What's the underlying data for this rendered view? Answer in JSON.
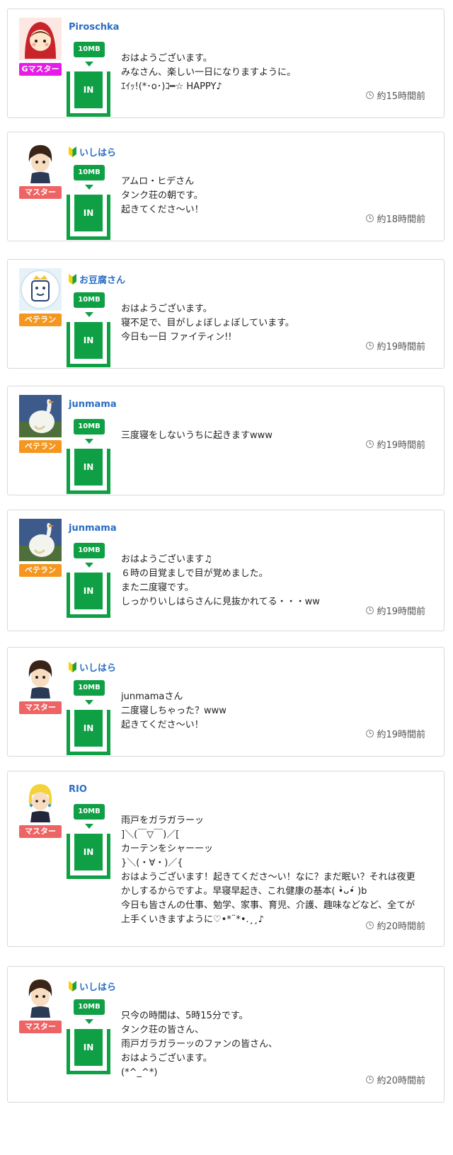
{
  "colors": {
    "in_green": "#0f9f45",
    "username_blue": "#2a6ec4",
    "rank_gmaster": "#e61ce6",
    "rank_master": "#ee6464",
    "rank_veteran": "#f5961e"
  },
  "posts": [
    {
      "username": "Piroschka",
      "rank": "Gマスター",
      "beginner": false,
      "size": "10MB",
      "status": "IN",
      "message": "おはようございます。\nみなさん、楽しい一日になりますように。\nｴｲｯ!(*･o･)ｺ━☆ HAPPY♪",
      "time": "約15時間前"
    },
    {
      "username": "いしはら",
      "rank": "マスター",
      "beginner": true,
      "size": "10MB",
      "status": "IN",
      "message": "アムロ・ヒデさん\nタンク荘の朝です。\n起きてくださ〜い！",
      "time": "約18時間前"
    },
    {
      "username": "お豆腐さん",
      "rank": "ベテラン",
      "beginner": true,
      "size": "10MB",
      "status": "IN",
      "message": "おはようございます。\n寝不足で、目がしょぼしょぼしています。\n今日も一日 ファイティン!!",
      "time": "約19時間前"
    },
    {
      "username": "junmama",
      "rank": "ベテラン",
      "beginner": false,
      "size": "10MB",
      "status": "IN",
      "message": "三度寝をしないうちに起きますwww",
      "time": "約19時間前"
    },
    {
      "username": "junmama",
      "rank": "ベテラン",
      "beginner": false,
      "size": "10MB",
      "status": "IN",
      "message": "おはようございます♫\n６時の目覚ましで目が覚めました。\nまた二度寝です。\nしっかりいしはらさんに見抜かれてる・・・ww",
      "time": "約19時間前"
    },
    {
      "username": "いしはら",
      "rank": "マスター",
      "beginner": true,
      "size": "10MB",
      "status": "IN",
      "message": "junmamaさん\n二度寝しちゃった？www\n起きてくださ〜い！",
      "time": "約19時間前"
    },
    {
      "username": "RIO",
      "rank": "マスター",
      "beginner": false,
      "size": "10MB",
      "status": "IN",
      "message": "雨戸をガラガラーッ\n]＼(￣▽￣)／[\nカーテンをシャーーッ\n}＼(・∀・)／{\nおはようございます！起きてくださ〜い！なに？まだ眠い？それは夜更かしするからですよ。早寝早起き、これ健康の基本( •̀ᴗ•́ )b\n今日も皆さんの仕事、勉学、家事、育児、介護、趣味などなど、全てが上手くいきますように♡•*¨*•.¸¸♪",
      "time": "約20時間前"
    },
    {
      "username": "いしはら",
      "rank": "マスター",
      "beginner": true,
      "size": "10MB",
      "status": "IN",
      "message": "只今の時間は、5時15分です。\nタンク荘の皆さん、\n雨戸ガラガラーッのファンの皆さん、\nおはようございます。\n(*^_^*)",
      "time": "約20時間前"
    }
  ]
}
